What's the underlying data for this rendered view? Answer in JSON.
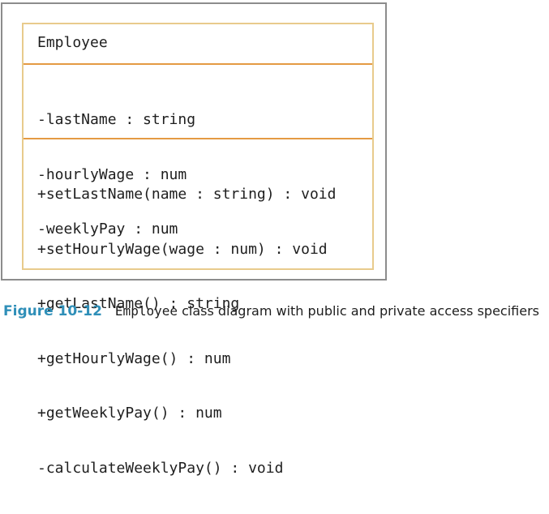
{
  "class_diagram": {
    "class_name": "Employee",
    "attributes": [
      "-lastName : string",
      "-hourlyWage : num",
      "-weeklyPay : num"
    ],
    "methods": [
      "+setLastName(name : string) : void",
      "+setHourlyWage(wage : num) : void",
      "+getLastName() : string",
      "+getHourlyWage() : num",
      "+getWeeklyPay() : num",
      "-calculateWeeklyPay() : void"
    ]
  },
  "caption": {
    "label": "Figure 10-12",
    "class_ref": "Employee",
    "text": " class diagram with public and private access specifiers"
  },
  "colors": {
    "frame_border": "#8c8c8c",
    "class_border": "#e8cb8c",
    "divider": "#e49a43",
    "caption_label": "#2f8fb8",
    "text": "#1e1e1e"
  }
}
